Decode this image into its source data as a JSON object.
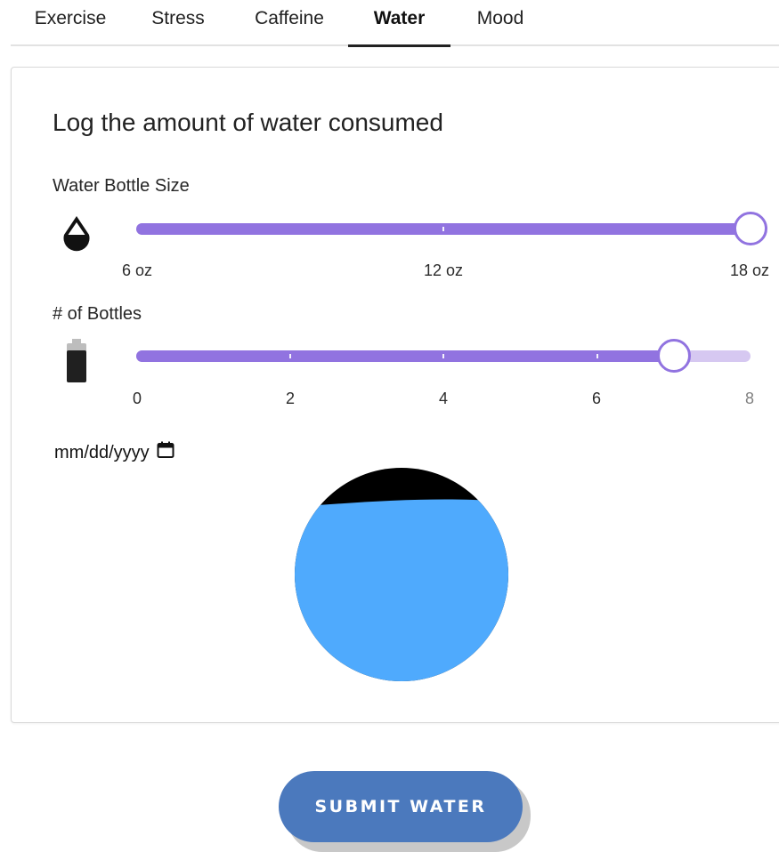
{
  "tabs": [
    {
      "label": "Exercise",
      "active": false
    },
    {
      "label": "Stress",
      "active": false
    },
    {
      "label": "Caffeine",
      "active": false
    },
    {
      "label": "Water",
      "active": true
    },
    {
      "label": "Mood",
      "active": false
    }
  ],
  "card": {
    "title": "Log the amount of water consumed",
    "bottle_size": {
      "label": "Water Bottle Size",
      "icon": "water-drop-icon",
      "value": 18,
      "unit": "oz",
      "min": 6,
      "max": 18,
      "marks": [
        "6 oz",
        "12 oz",
        "18 oz"
      ]
    },
    "bottles": {
      "label": "# of Bottles",
      "icon": "battery-icon",
      "value": 7,
      "min": 0,
      "max": 8,
      "marks": [
        "0",
        "2",
        "4",
        "6",
        "8"
      ]
    },
    "date": {
      "placeholder": "mm/dd/yyyy",
      "icon": "calendar-icon"
    },
    "water_level": {
      "icon": "water-fill-circle",
      "fill_fraction": 0.85,
      "water_color": "#4faafd",
      "empty_color": "#000000"
    }
  },
  "submit": {
    "label": "SUBMIT WATER"
  },
  "colors": {
    "accent": "#9173e0",
    "accent_light": "#d6c8f1",
    "button": "#4b79bd"
  }
}
